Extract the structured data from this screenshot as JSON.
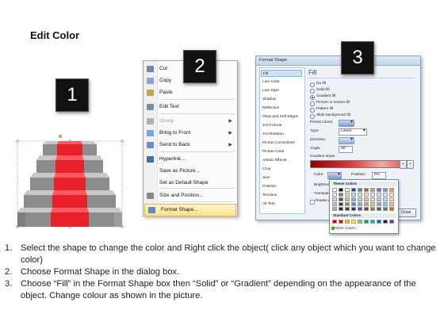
{
  "title": "Edit Color",
  "badges": [
    "1",
    "2",
    "3"
  ],
  "context_menu": {
    "items": [
      {
        "label": "Cut",
        "icon": "scissors-icon",
        "disabled": false,
        "submenu": false
      },
      {
        "label": "Copy",
        "icon": "copy-icon",
        "disabled": false,
        "submenu": false
      },
      {
        "label": "Paste",
        "icon": "paste-icon",
        "disabled": false,
        "submenu": false
      },
      {
        "label": "Edit Text",
        "icon": "edit-text-icon",
        "disabled": false,
        "submenu": false
      },
      {
        "label": "Group",
        "icon": "group-icon",
        "disabled": true,
        "submenu": true
      },
      {
        "label": "Bring to Front",
        "icon": "bring-to-front-icon",
        "disabled": false,
        "submenu": true
      },
      {
        "label": "Send to Back",
        "icon": "send-to-back-icon",
        "disabled": false,
        "submenu": true
      },
      {
        "label": "Hyperlink...",
        "icon": "hyperlink-icon",
        "disabled": false,
        "submenu": false
      },
      {
        "label": "Save as Picture...",
        "icon": "",
        "disabled": false,
        "submenu": false
      },
      {
        "label": "Set as Default Shape",
        "icon": "",
        "disabled": false,
        "submenu": false
      },
      {
        "label": "Size and Position...",
        "icon": "size-position-icon",
        "disabled": false,
        "submenu": false
      },
      {
        "label": "Format Shape...",
        "icon": "format-shape-icon",
        "disabled": false,
        "submenu": false,
        "highlighted": true
      }
    ]
  },
  "dialog": {
    "title": "Format Shape",
    "nav": [
      "Fill",
      "Line Color",
      "Line Style",
      "Shadow",
      "Reflection",
      "Glow and Soft Edges",
      "3-D Format",
      "3-D Rotation",
      "Picture Corrections",
      "Picture Color",
      "Artistic Effects",
      "Crop",
      "Size",
      "Position",
      "Text Box",
      "Alt Text"
    ],
    "pane_title": "Fill",
    "fill_options": [
      "No fill",
      "Solid fill",
      "Gradient fill",
      "Picture or texture fill",
      "Pattern fill",
      "Slide background fill"
    ],
    "selected_fill": "Gradient fill",
    "preset_colors_label": "Preset colors:",
    "type_label": "Type:",
    "type_value": "Linear",
    "direction_label": "Direction:",
    "angle_label": "Angle:",
    "angle_value": "90°",
    "gradient_stops_label": "Gradient stops",
    "color_label": "Color",
    "position_label": "Position:",
    "position_value": "0%",
    "brightness_label": "Brightness",
    "transparency_label": "Transparency",
    "rotate_label": "Rotate w",
    "close_button": "Close"
  },
  "palette": {
    "theme_header": "Theme Colors",
    "standard_header": "Standard Colors",
    "more_label": "More Colors...",
    "theme_rows": [
      [
        "#ffffff",
        "#000000",
        "#eeece1",
        "#1f497d",
        "#4f81bd",
        "#c0504d",
        "#9bbb59",
        "#8064a2",
        "#4bacc6",
        "#f79646"
      ],
      [
        "#f2f2f2",
        "#7f7f7f",
        "#ddd9c3",
        "#c6d9f0",
        "#dbe5f1",
        "#f2dcdb",
        "#ebf1dd",
        "#e5e0ec",
        "#dbeef3",
        "#fdeada"
      ],
      [
        "#d8d8d8",
        "#595959",
        "#c4bd97",
        "#8db3e2",
        "#b8cce4",
        "#e5b9b7",
        "#d7e3bc",
        "#ccc1d9",
        "#b7dde8",
        "#fbd5b5"
      ],
      [
        "#bfbfbf",
        "#3f3f3f",
        "#938953",
        "#548dd4",
        "#95b3d7",
        "#d99694",
        "#c3d69b",
        "#b2a2c7",
        "#92cddc",
        "#fac08f"
      ],
      [
        "#a5a5a5",
        "#262626",
        "#494429",
        "#17365d",
        "#366092",
        "#953734",
        "#76923c",
        "#5f497a",
        "#31859b",
        "#e36c09"
      ]
    ],
    "standard": [
      "#c00000",
      "#ff0000",
      "#ffc000",
      "#ffff00",
      "#92d050",
      "#00b050",
      "#00b0f0",
      "#0070c0",
      "#002060",
      "#7030a0"
    ]
  },
  "steps": [
    {
      "num": "1.",
      "text": "Select the shape to change the color and Right click the object( click any object which you want to change color)"
    },
    {
      "num": "2.",
      "text": "Choose Format Shape in the dialog box."
    },
    {
      "num": "3.",
      "text": "Choose “Fill” in the Format Shape box then “Solid” or “Gradient” depending on the appearance of the object. Change colour as shown in the picture."
    }
  ],
  "colors": {
    "carpet": "#e8202a",
    "step_gray": "#9a9a9a",
    "highlight": "#ffe08a",
    "badge": "#111111"
  }
}
